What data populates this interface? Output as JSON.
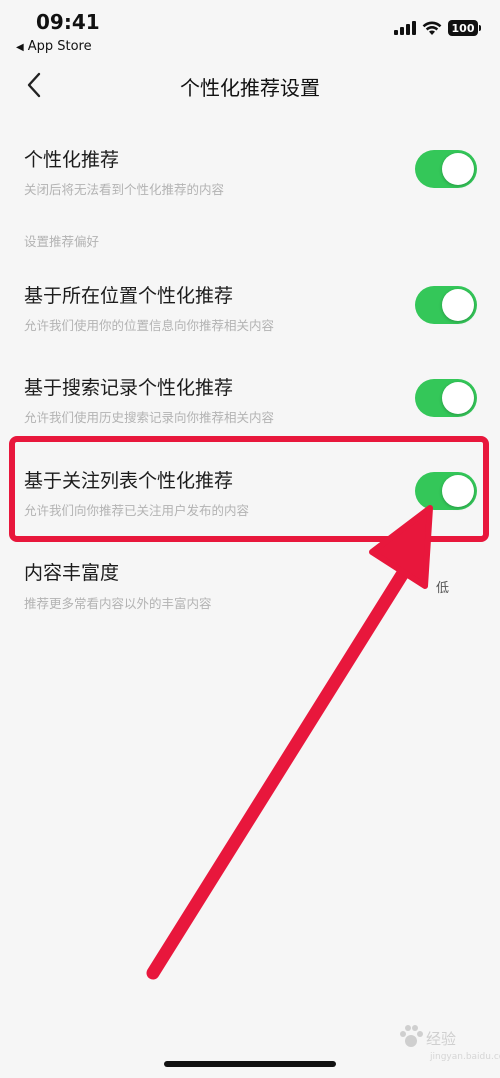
{
  "status_bar": {
    "time": "09:41",
    "back_app": "App Store",
    "battery": "100"
  },
  "nav": {
    "title": "个性化推荐设置"
  },
  "section_label": "设置推荐偏好",
  "settings": [
    {
      "title": "个性化推荐",
      "desc": "关闭后将无法看到个性化推荐的内容",
      "enabled": true
    },
    {
      "title": "基于所在位置个性化推荐",
      "desc": "允许我们使用你的位置信息向你推荐相关内容",
      "enabled": true
    },
    {
      "title": "基于搜索记录个性化推荐",
      "desc": "允许我们使用历史搜索记录向你推荐相关内容",
      "enabled": true
    },
    {
      "title": "基于关注列表个性化推荐",
      "desc": "允许我们向你推荐已关注用户发布的内容",
      "enabled": true
    }
  ],
  "richness": {
    "title": "内容丰富度",
    "desc": "推荐更多常看内容以外的丰富内容",
    "value": "低"
  },
  "watermark": {
    "text": "经验",
    "url": "jingyan.baidu.com"
  },
  "colors": {
    "toggle_on": "#34c759",
    "highlight": "#e8173c",
    "background": "#f6f6f6"
  }
}
